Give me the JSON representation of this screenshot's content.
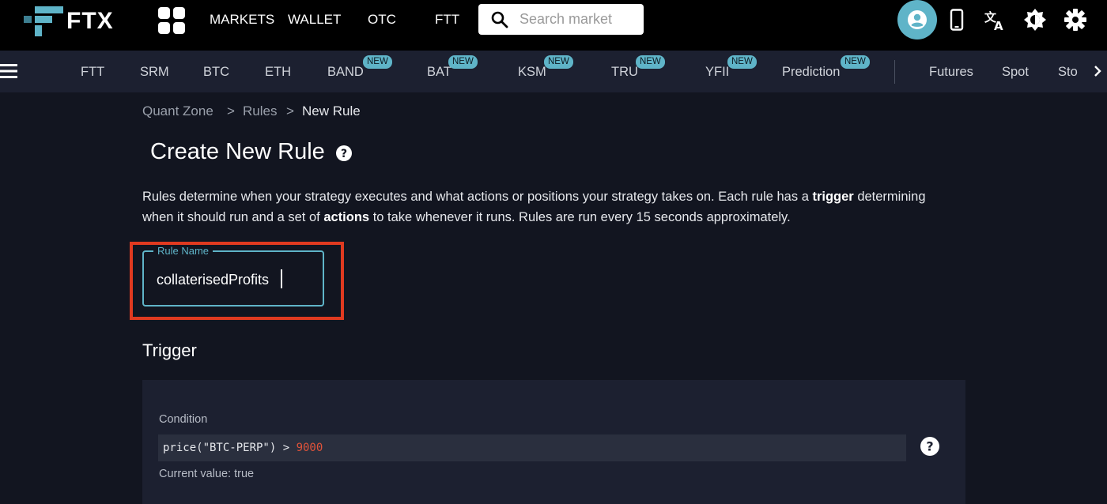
{
  "header": {
    "brand": "FTX",
    "nav": [
      "MARKETS",
      "WALLET",
      "OTC",
      "FTT"
    ],
    "search": {
      "placeholder": "Search market",
      "value": ""
    }
  },
  "icons": {
    "apps": "grid-icon",
    "search": "search-icon",
    "user": "user-icon",
    "mobile": "mobile-phone-icon",
    "translate": "translate-icon",
    "theme": "brightness-icon",
    "settings": "gear-icon",
    "menu": "hamburger-menu-icon"
  },
  "tabs": {
    "markets": [
      {
        "label": "FTT",
        "badge": ""
      },
      {
        "label": "SRM",
        "badge": ""
      },
      {
        "label": "BTC",
        "badge": ""
      },
      {
        "label": "ETH",
        "badge": ""
      },
      {
        "label": "BAND",
        "badge": "NEW"
      },
      {
        "label": "BAT",
        "badge": "NEW"
      },
      {
        "label": "KSM",
        "badge": "NEW"
      },
      {
        "label": "TRU",
        "badge": "NEW"
      },
      {
        "label": "YFII",
        "badge": "NEW"
      },
      {
        "label": "Prediction",
        "badge": "NEW"
      }
    ],
    "categories": [
      "Futures",
      "Spot",
      "Sto"
    ]
  },
  "breadcrumb": [
    {
      "label": "Quant Zone"
    },
    {
      "label": "Rules"
    },
    {
      "label": "New Rule"
    }
  ],
  "breadcrumb_separator": ">",
  "page": {
    "title": "Create New Rule",
    "description": {
      "part1": "Rules determine when your strategy executes and what actions or positions your strategy takes on. Each rule has a ",
      "bold1": "trigger",
      "part2": " determining when it should run and a set of ",
      "bold2": "actions",
      "part3": " to take whenever it runs. Rules are run every 15 seconds approximately."
    }
  },
  "rule_name": {
    "label": "Rule Name",
    "value": "collaterisedProfits"
  },
  "trigger": {
    "section_title": "Trigger",
    "condition_label": "Condition",
    "condition_code": "price(\"BTC-PERP\") > ",
    "condition_number": "9000",
    "current_value": "Current value: true"
  },
  "colors": {
    "accent": "#5fb4c8",
    "highlight_border": "#e03a20",
    "background": "#121520",
    "panel": "#1c2030",
    "code_number": "#e0533a"
  }
}
